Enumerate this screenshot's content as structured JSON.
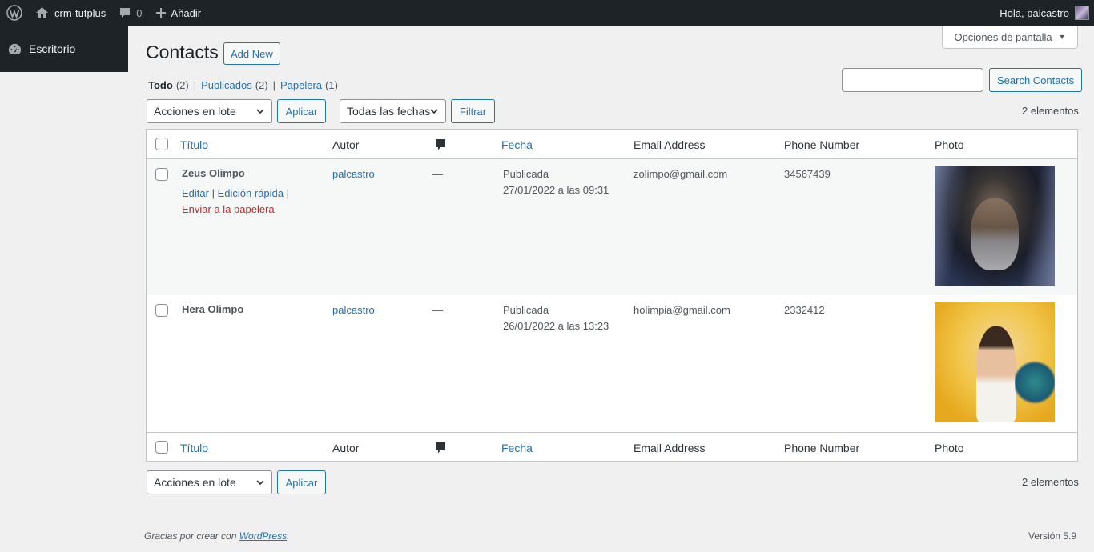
{
  "adminbar": {
    "site_name": "crm-tutplus",
    "comments_count": "0",
    "new_label": "Añadir",
    "greeting": "Hola, palcastro"
  },
  "sidebar": {
    "items": [
      {
        "label": "Escritorio",
        "icon": "dashboard-icon"
      }
    ]
  },
  "screen_options": {
    "label": "Opciones de pantalla",
    "arrow": "▼"
  },
  "page": {
    "title": "Contacts",
    "add_new": "Add New"
  },
  "views": [
    {
      "label": "Todo",
      "count": "(2)",
      "current": true
    },
    {
      "label": "Publicados",
      "count": "(2)"
    },
    {
      "label": "Papelera",
      "count": "(1)"
    }
  ],
  "views_sep": "|",
  "search": {
    "placeholder": "",
    "button": "Search Contacts"
  },
  "tablenav_top": {
    "bulk_action": "Acciones en lote",
    "apply": "Aplicar",
    "date_filter": "Todas las fechas",
    "filter": "Filtrar",
    "count": "2 elementos"
  },
  "tablenav_bottom": {
    "bulk_action": "Acciones en lote",
    "apply": "Aplicar",
    "count": "2 elementos"
  },
  "columns": {
    "title": "Título",
    "author": "Autor",
    "date": "Fecha",
    "email": "Email Address",
    "phone": "Phone Number",
    "photo": "Photo"
  },
  "rows": [
    {
      "title": "Zeus Olimpo",
      "author": "palcastro",
      "comments": "—",
      "status": "Publicada",
      "date": "27/01/2022 a las 09:31",
      "email": "zolimpo@gmail.com",
      "phone": "34567439",
      "actions": {
        "edit": "Editar",
        "quick_edit": "Edición rápida",
        "trash": "Enviar a la papelera",
        "sep": "|"
      }
    },
    {
      "title": "Hera Olimpo",
      "author": "palcastro",
      "comments": "—",
      "status": "Publicada",
      "date": "26/01/2022 a las 13:23",
      "email": "holimpia@gmail.com",
      "phone": "2332412"
    }
  ],
  "footer": {
    "thanks_prefix": "Gracias por crear con ",
    "thanks_link": "WordPress",
    "thanks_suffix": ".",
    "version": "Versión 5.9"
  },
  "colors": {
    "adminbar_bg": "#1d2327",
    "link": "#2271b1",
    "trash": "#b32d2e",
    "body_bg": "#f0f0f1"
  }
}
